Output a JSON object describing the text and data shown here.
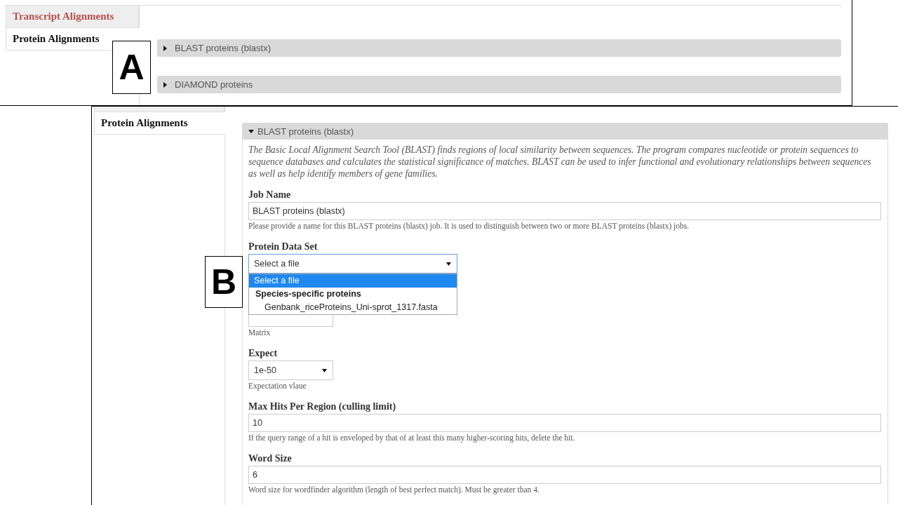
{
  "panel_a": {
    "label": "A",
    "tabs": [
      {
        "label": "Transcript Alignments",
        "selected": false
      },
      {
        "label": "Protein Alignments",
        "selected": true
      }
    ],
    "sections": [
      {
        "title": "BLAST proteins (blastx)",
        "expanded": false
      },
      {
        "title": "DIAMOND proteins",
        "expanded": false
      }
    ]
  },
  "panel_b": {
    "label": "B",
    "tabs": [
      {
        "selected": false
      },
      {
        "label": "Protein Alignments",
        "selected": true
      }
    ],
    "sections": [
      {
        "title": "BLAST proteins (blastx)",
        "expanded": true,
        "description": "The Basic Local Alignment Search Tool (BLAST) finds regions of local similarity between sequences. The program compares nucleotide or protein sequences to sequence databases and calculates the statistical significance of matches. BLAST can be used to infer functional and evolutionary relationships between sequences as well as help identify members of gene families.",
        "fields": [
          {
            "kind": "text",
            "label": "Job Name",
            "value": "BLAST proteins (blastx)",
            "hint": "Please provide a name for this BLAST proteins (blastx) job. It is used to distinguish between two or more BLAST proteins (blastx) jobs."
          },
          {
            "kind": "dataset",
            "label": "Protein Data Set",
            "value": "Select a file",
            "open": true,
            "options": [
              {
                "kind": "option",
                "label": "Select a file",
                "selected": true
              },
              {
                "kind": "group",
                "label": "Species-specific proteins",
                "children": [
                  {
                    "kind": "option",
                    "label": "Genbank_riceProteins_Uni-sprot_1317.fasta",
                    "selected": false
                  }
                ]
              }
            ]
          },
          {
            "kind": "select",
            "open": false,
            "hint": "Matrix"
          },
          {
            "kind": "select",
            "label": "Expect",
            "value": "1e-50",
            "open": false,
            "hint": "Expectation vlaue"
          },
          {
            "kind": "text",
            "label": "Max Hits Per Region (culling limit)",
            "value": "10",
            "hint": "If the query range of a hit is enveloped by that of at least this many higher-scoring hits, delete the hit."
          },
          {
            "kind": "text",
            "label": "Word Size",
            "value": "6",
            "hint": "Word size for wordfinder algorithm (length of best perfect match). Must be greater than 4."
          }
        ]
      }
    ]
  }
}
